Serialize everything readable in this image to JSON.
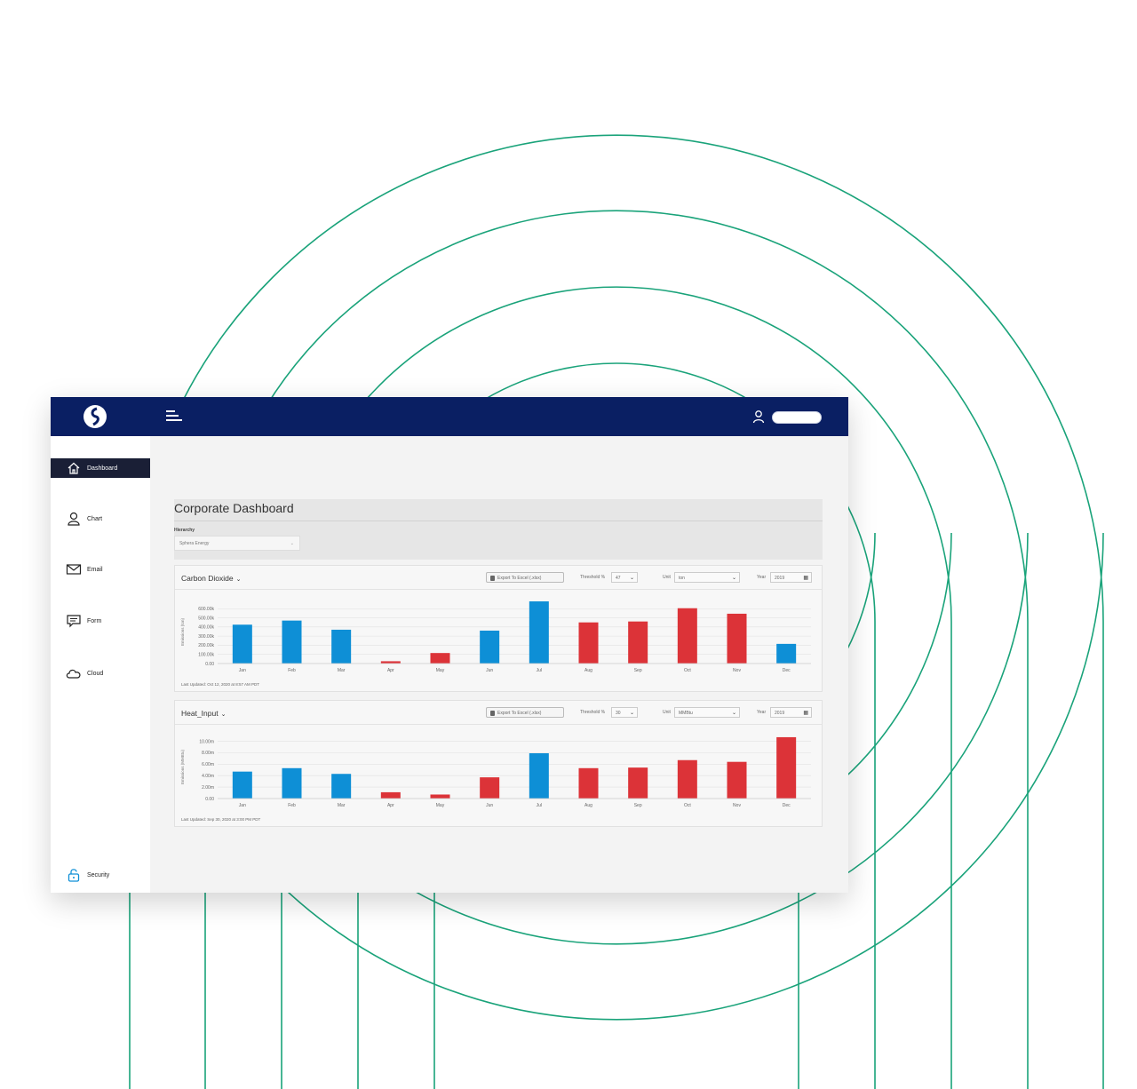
{
  "sidebar": {
    "items": [
      {
        "label": "Dashboard",
        "icon": "home-icon",
        "active": true
      },
      {
        "label": "Chart",
        "icon": "user-icon"
      },
      {
        "label": "Email",
        "icon": "envelope-icon"
      },
      {
        "label": "Form",
        "icon": "chat-icon"
      },
      {
        "label": "Cloud",
        "icon": "cloud-icon"
      }
    ],
    "security": {
      "label": "Security",
      "icon": "lock-icon"
    }
  },
  "header": {
    "menu_icon": "hamburger-icon",
    "user_icon": "user-icon"
  },
  "page": {
    "title": "Corporate Dashboard",
    "hierarchy_label": "Hierarchy",
    "hierarchy_value": "Sphera Energy"
  },
  "panels": [
    {
      "title": "Carbon Dioxide",
      "export_label": "Export To Excel (.xlsx)",
      "threshold_label": "Threshold %",
      "threshold_value": "47",
      "unit_label": "Unit",
      "unit_value": "ton",
      "year_label": "Year",
      "year_value": "2019",
      "last_updated": "Last Updated: Oct 12, 2020 at 8:57 AM PDT"
    },
    {
      "title": "Heat_Input",
      "export_label": "Export To Excel (.xlsx)",
      "threshold_label": "Threshold %",
      "threshold_value": "30",
      "unit_label": "Unit",
      "unit_value": "MMBtu",
      "year_label": "Year",
      "year_value": "2019",
      "last_updated": "Last Updated: Sep 30, 2020 at 3:00 PM PDT"
    }
  ],
  "colors": {
    "nav_bg": "#0a1f63",
    "below_threshold": "#0e8fd6",
    "above_threshold": "#dc3338",
    "arc_stroke": "#1aa37a"
  },
  "chart_data": [
    {
      "type": "bar",
      "categories": [
        "Jan",
        "Feb",
        "Mar",
        "Apr",
        "May",
        "Jun",
        "Jul",
        "Aug",
        "Sep",
        "Oct",
        "Nov",
        "Dec"
      ],
      "values": [
        425000,
        470000,
        370000,
        25000,
        115000,
        360000,
        680000,
        450000,
        460000,
        605000,
        545000,
        215000
      ],
      "bar_colors": [
        "#0e8fd6",
        "#0e8fd6",
        "#0e8fd6",
        "#dc3338",
        "#dc3338",
        "#0e8fd6",
        "#0e8fd6",
        "#dc3338",
        "#dc3338",
        "#dc3338",
        "#dc3338",
        "#0e8fd6"
      ],
      "yticks": [
        "0.00",
        "100.00k",
        "200.00k",
        "300.00k",
        "400.00k",
        "500.00k",
        "600.00k"
      ],
      "ylim": [
        0,
        690000
      ],
      "ylabel": "Emissions (ton)",
      "grid": true
    },
    {
      "type": "bar",
      "categories": [
        "Jan",
        "Feb",
        "Mar",
        "Apr",
        "May",
        "Jun",
        "Jul",
        "Aug",
        "Sep",
        "Oct",
        "Nov",
        "Dec"
      ],
      "values": [
        4700000,
        5300000,
        4300000,
        1100000,
        700000,
        3700000,
        7900000,
        5300000,
        5400000,
        6700000,
        6400000,
        10700000
      ],
      "bar_colors": [
        "#0e8fd6",
        "#0e8fd6",
        "#0e8fd6",
        "#dc3338",
        "#dc3338",
        "#dc3338",
        "#0e8fd6",
        "#dc3338",
        "#dc3338",
        "#dc3338",
        "#dc3338",
        "#dc3338"
      ],
      "yticks": [
        "0.00",
        "2.00m",
        "4.00m",
        "6.00m",
        "8.00m",
        "10.00m"
      ],
      "ylim": [
        0,
        11000000
      ],
      "ylabel": "Emissions (MMBtu)",
      "grid": true
    }
  ]
}
